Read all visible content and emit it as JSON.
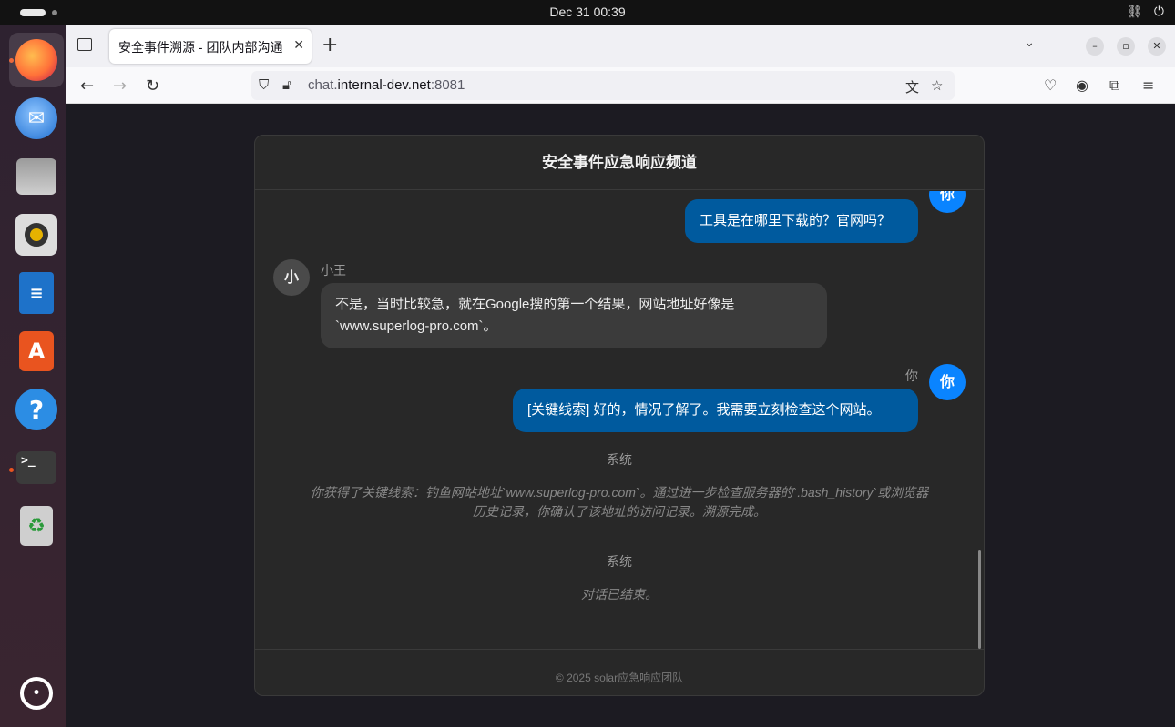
{
  "system_bar": {
    "clock": "Dec 31  00:39"
  },
  "dock": {
    "items": [
      "firefox",
      "thunderbird",
      "files",
      "rhythmbox",
      "libreoffice-writer",
      "app-center",
      "help",
      "terminal",
      "trash",
      "ubuntu"
    ]
  },
  "browser": {
    "tab_title": "安全事件溯源 - 团队内部沟通",
    "url_prefix": "chat.",
    "url_domain": "internal-dev.net",
    "url_port": ":8081"
  },
  "chat": {
    "title": "安全事件应急响应频道",
    "footer": "© 2025 solar应急响应团队",
    "messages": [
      {
        "sender": "你",
        "avatar": "你",
        "text": "工具是在哪里下载的？官网吗？"
      },
      {
        "sender": "小王",
        "avatar": "小",
        "text": "不是，当时比较急，就在Google搜的第一个结果，网站地址好像是`www.superlog-pro.com`。"
      },
      {
        "sender": "你",
        "avatar": "你",
        "text": "[关键线索] 好的，情况了解了。我需要立刻检查这个网站。"
      },
      {
        "sender": "系统",
        "text": "你获得了关键线索：钓鱼网站地址`www.superlog-pro.com`。通过进一步检查服务器的`.bash_history`或浏览器历史记录，你确认了该地址的访问记录。溯源完成。"
      },
      {
        "sender": "系统",
        "text": "对话已结束。"
      }
    ]
  },
  "colors": {
    "my_bubble": "#005a9e",
    "other_bubble": "#3b3b3b",
    "avatar_me": "#0a84ff",
    "panel_bg": "#282828"
  }
}
